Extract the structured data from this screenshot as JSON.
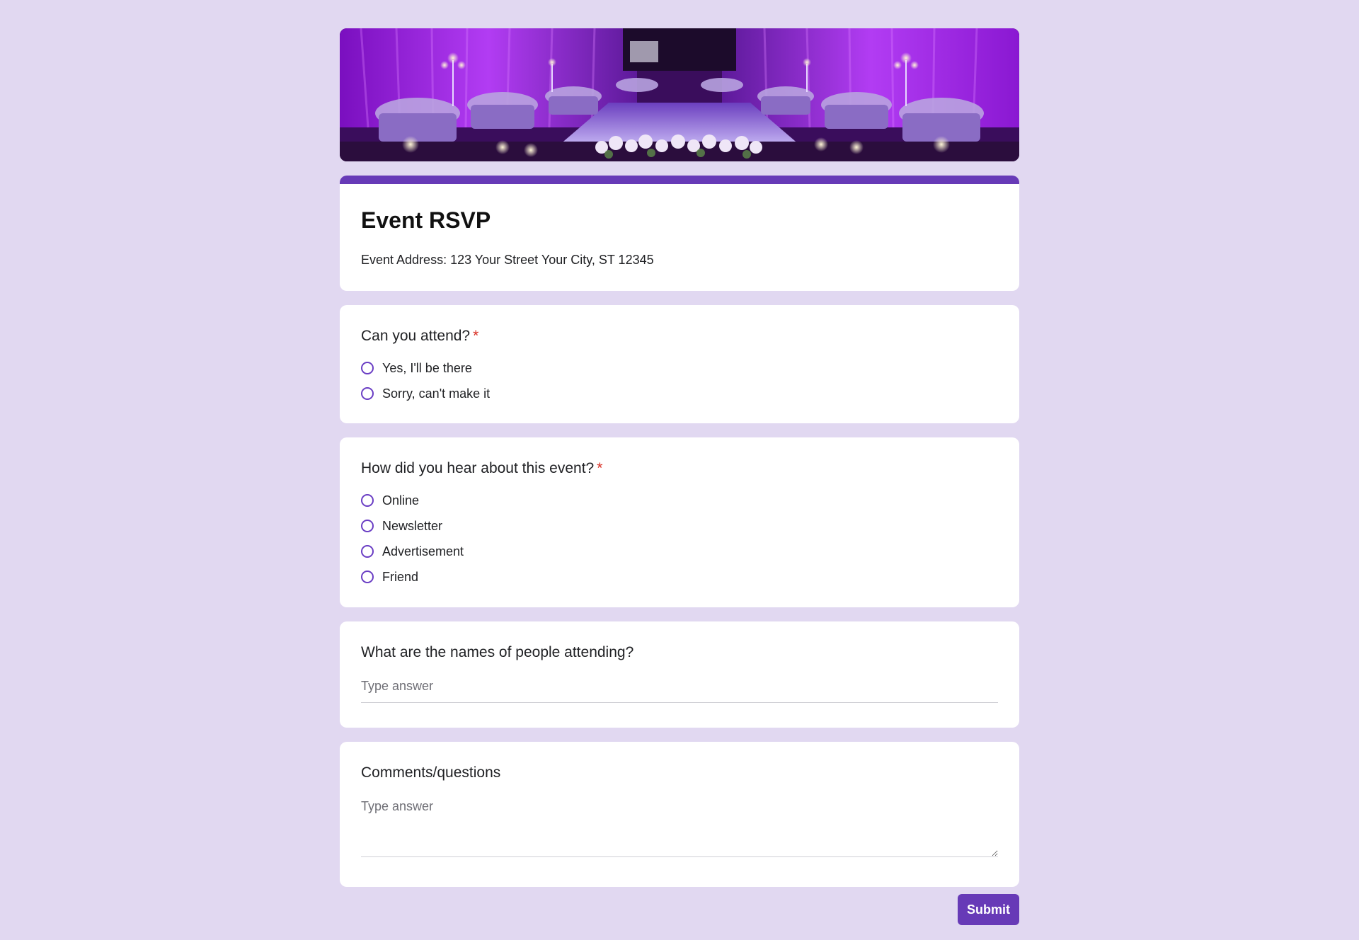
{
  "theme": {
    "background": "#e1d8f1",
    "accent": "#673ab7",
    "required": "#d93025"
  },
  "banner": {
    "icon": "event-hall-image"
  },
  "form": {
    "title": "Event RSVP",
    "description": "Event Address: 123 Your Street Your City, ST 12345"
  },
  "questions": {
    "attend": {
      "title": "Can you attend?",
      "required_mark": "*",
      "options": [
        "Yes, I'll be there",
        "Sorry, can't make it"
      ]
    },
    "hear": {
      "title": "How did you hear about this event?",
      "required_mark": "*",
      "options": [
        "Online",
        "Newsletter",
        "Advertisement",
        "Friend"
      ]
    },
    "names": {
      "title": "What are the names of people attending?",
      "placeholder": "Type answer"
    },
    "comments": {
      "title": "Comments/questions",
      "placeholder": "Type answer"
    }
  },
  "submit": {
    "label": "Submit"
  }
}
